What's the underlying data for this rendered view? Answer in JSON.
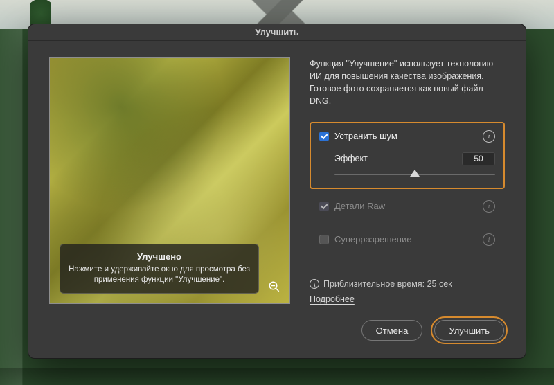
{
  "dialog": {
    "title": "Улучшить",
    "description": "Функция \"Улучшение\" использует технологию ИИ для повышения качества изображения. Готовое фото сохраняется как новый файл DNG."
  },
  "preview": {
    "overlay_title": "Улучшено",
    "overlay_text": "Нажмите и удерживайте окно для просмотра без применения функции \"Улучшение\"."
  },
  "options": {
    "denoise": {
      "label": "Устранить шум",
      "checked": true,
      "enabled": true
    },
    "denoise_effect": {
      "label": "Эффект",
      "value": "50"
    },
    "raw_details": {
      "label": "Детали Raw",
      "checked": true,
      "enabled": false
    },
    "super_resolution": {
      "label": "Суперразрешение",
      "checked": false,
      "enabled": false
    }
  },
  "time": {
    "label": "Приблизительное время: 25 сек"
  },
  "learn_more": "Подробнее",
  "buttons": {
    "cancel": "Отмена",
    "enhance": "Улучшить"
  },
  "colors": {
    "highlight": "#d68a2e",
    "accent": "#2b72d6"
  }
}
